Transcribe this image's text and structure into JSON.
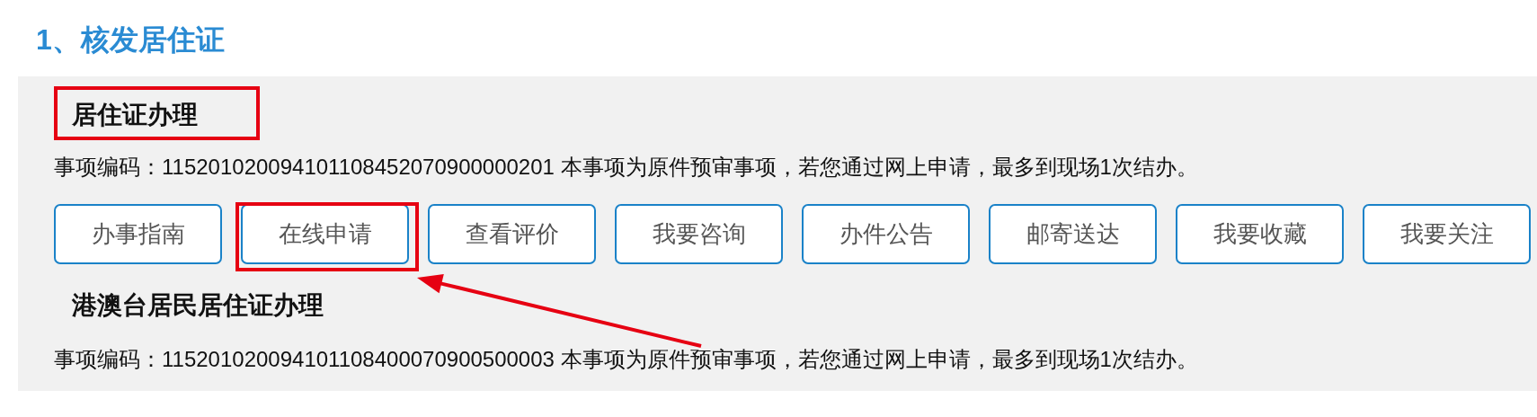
{
  "heading": "1、核发居住证",
  "items": [
    {
      "title": "居住证办理",
      "code_line": "事项编码：115201020094101108452070900000201 本事项为原件预审事项，若您通过网上申请，最多到现场1次结办。",
      "buttons": [
        "办事指南",
        "在线申请",
        "查看评价",
        "我要咨询",
        "办件公告",
        "邮寄送达",
        "我要收藏",
        "我要关注"
      ]
    },
    {
      "title": "港澳台居民居住证办理",
      "code_line": "事项编码：115201020094101108400070900500003 本事项为原件预审事项，若您通过网上申请，最多到现场1次结办。"
    }
  ]
}
